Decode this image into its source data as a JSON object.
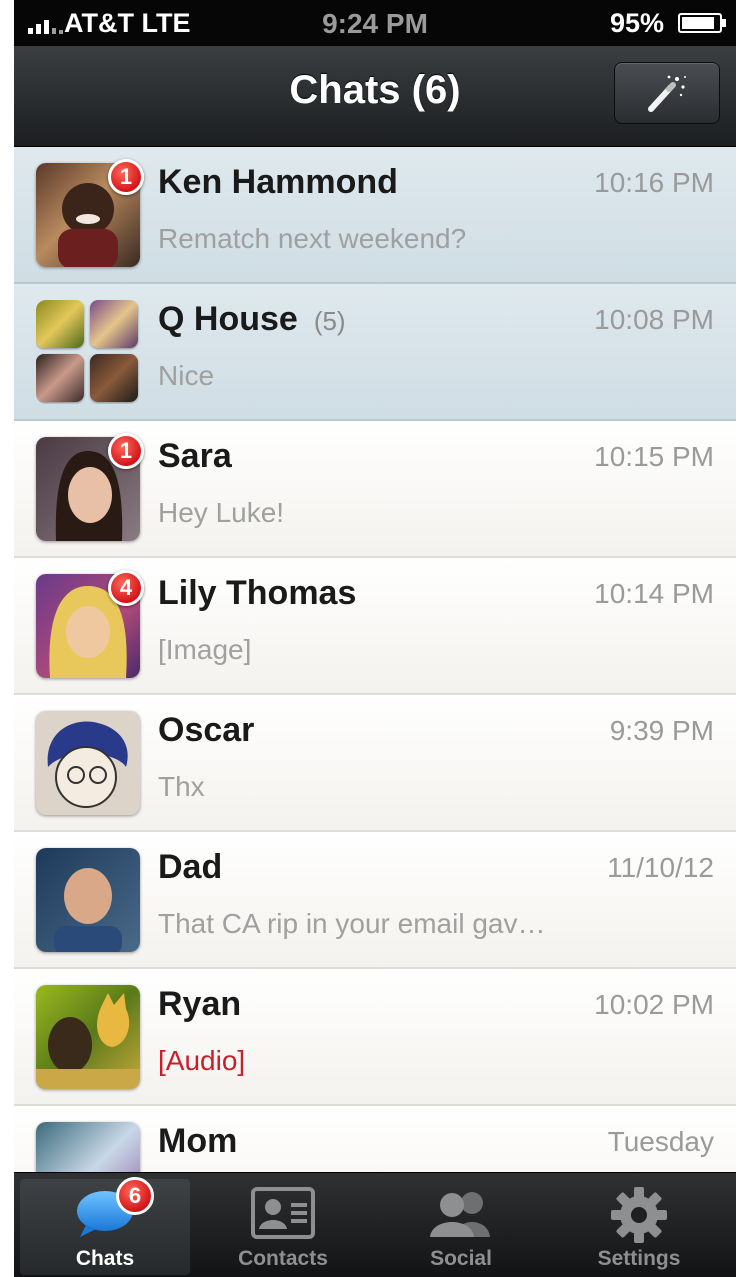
{
  "status_bar": {
    "carrier": "AT&T  LTE",
    "time": "9:24 PM",
    "battery": "95%",
    "battery_level": 0.95
  },
  "nav": {
    "title": "Chats (6)",
    "action_icon": "magic-wand-icon"
  },
  "chats": [
    {
      "name": "Ken Hammond",
      "count": "",
      "time": "10:16 PM",
      "preview": "Rematch next weekend?",
      "badge": "1",
      "highlighted": true,
      "preview_color": "#a0a0a0"
    },
    {
      "name": "Q House",
      "count": "(5)",
      "time": "10:08 PM",
      "preview": "Nice",
      "badge": "",
      "highlighted": true,
      "group": true,
      "preview_color": "#a0a0a0"
    },
    {
      "name": "Sara",
      "count": "",
      "time": "10:15 PM",
      "preview": "Hey Luke!",
      "badge": "1",
      "highlighted": false,
      "preview_color": "#a0a0a0"
    },
    {
      "name": "Lily Thomas",
      "count": "",
      "time": "10:14 PM",
      "preview": "[Image]",
      "badge": "4",
      "highlighted": false,
      "preview_color": "#a0a0a0"
    },
    {
      "name": "Oscar",
      "count": "",
      "time": "9:39 PM",
      "preview": "Thx",
      "badge": "",
      "highlighted": false,
      "preview_color": "#a0a0a0"
    },
    {
      "name": "Dad",
      "count": "",
      "time": "11/10/12",
      "preview": "That CA rip in your email gav…",
      "badge": "",
      "highlighted": false,
      "preview_color": "#a0a0a0"
    },
    {
      "name": "Ryan",
      "count": "",
      "time": "10:02 PM",
      "preview": "[Audio]",
      "badge": "",
      "highlighted": false,
      "preview_color": "#c8202a"
    },
    {
      "name": "Mom",
      "count": "",
      "time": "Tuesday",
      "preview": "",
      "badge": "",
      "highlighted": false,
      "preview_color": "#a0a0a0"
    }
  ],
  "tabs": [
    {
      "label": "Chats",
      "icon": "chat-bubble-icon",
      "badge": "6",
      "active": true
    },
    {
      "label": "Contacts",
      "icon": "contact-card-icon",
      "badge": "",
      "active": false
    },
    {
      "label": "Social",
      "icon": "people-icon",
      "badge": "",
      "active": false
    },
    {
      "label": "Settings",
      "icon": "gear-icon",
      "badge": "",
      "active": false
    }
  ],
  "colors": {
    "highlight_row": "#d6e3e9",
    "badge_red": "#d3151a",
    "audio_red": "#c8202a"
  }
}
